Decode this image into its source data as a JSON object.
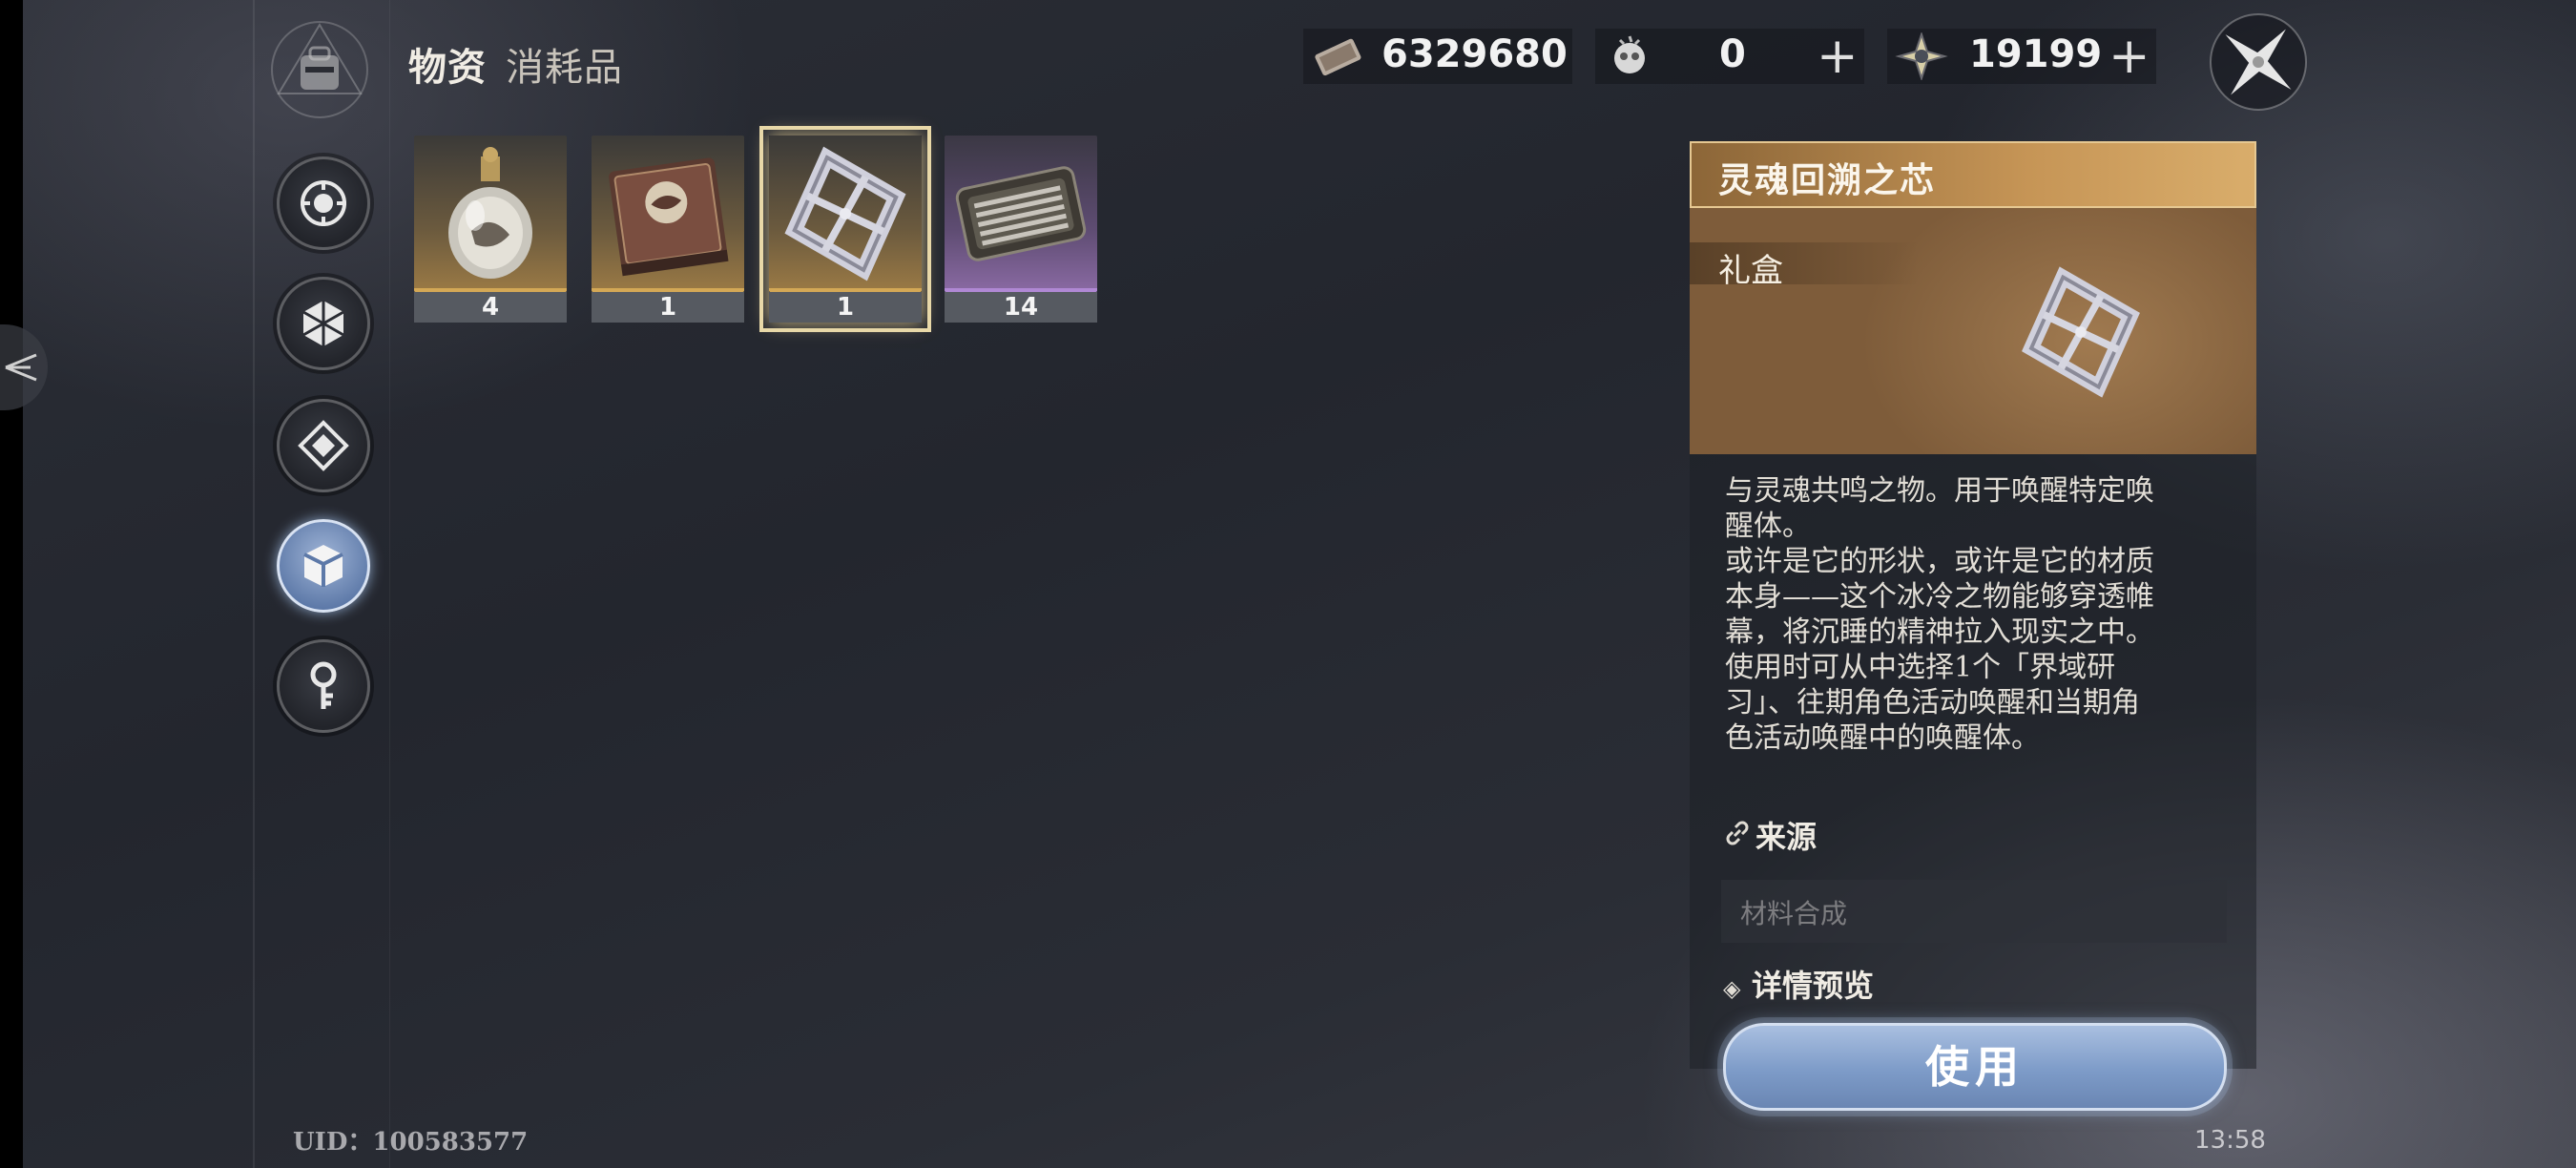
{
  "header": {
    "title": "物资",
    "subtitle": "消耗品",
    "emblem_icon": "backpack-emblem-icon"
  },
  "currencies": [
    {
      "icon": "ticket-icon",
      "value": "6329680"
    },
    {
      "icon": "skull-orb-icon",
      "value": "0",
      "plus": "+"
    },
    {
      "icon": "star-crystal-icon",
      "value": "19199",
      "plus": "+"
    }
  ],
  "sidebar": {
    "items": [
      {
        "name": "compass-tab",
        "icon": "compass-icon"
      },
      {
        "name": "hexagon-tab",
        "icon": "hexagon-icon"
      },
      {
        "name": "diamond-tab",
        "icon": "diamond-icon"
      },
      {
        "name": "cube-tab",
        "icon": "cube-icon",
        "active": true
      },
      {
        "name": "key-tab",
        "icon": "key-icon"
      }
    ]
  },
  "inventory": {
    "items": [
      {
        "icon": "potion-flask-icon",
        "qty": "4",
        "rarity": "gold"
      },
      {
        "icon": "book-icon",
        "qty": "1",
        "rarity": "gold"
      },
      {
        "icon": "crystal-frame-icon",
        "qty": "1",
        "rarity": "gold",
        "selected": true
      },
      {
        "icon": "tool-case-icon",
        "qty": "14",
        "rarity": "purple"
      }
    ]
  },
  "detail": {
    "name": "灵魂回溯之芯",
    "type": "礼盒",
    "description": "与灵魂共鸣之物。用于唤醒特定唤\n醒体。\n或许是它的形状，或许是它的材质\n本身——这个冰冷之物能够穿透帷\n幕，将沉睡的精神拉入现实之中。\n使用时可从中选择1个「界域研\n习」、往期角色活动唤醒和当期角\n色活动唤醒中的唤醒体。",
    "source_label": "来源",
    "source_value": "材料合成",
    "preview_label": "详情预览",
    "use_label": "使用"
  },
  "footer": {
    "uid": "UID：100583577",
    "time": "13:58"
  },
  "colors": {
    "accent_gold": "#c69556",
    "use_button": "#7d9bc8",
    "rarity_purple": "#8a6aa3"
  }
}
